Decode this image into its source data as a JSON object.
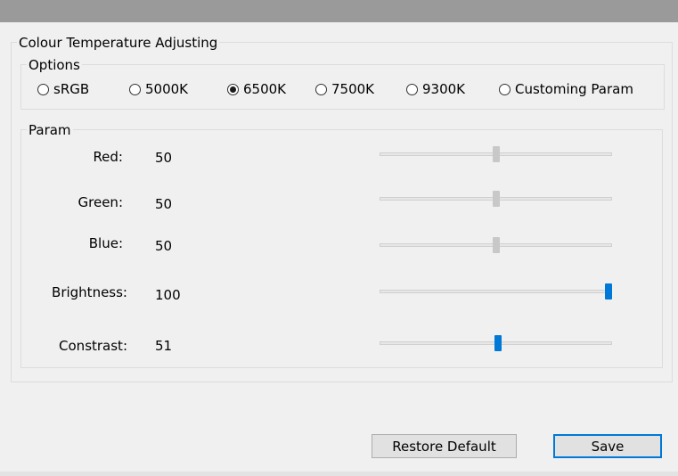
{
  "window": {
    "group_title": "Colour Temperature Adjusting"
  },
  "options": {
    "legend": "Options",
    "items": [
      {
        "label": "sRGB",
        "checked": false
      },
      {
        "label": "5000K",
        "checked": false
      },
      {
        "label": "6500K",
        "checked": true
      },
      {
        "label": "7500K",
        "checked": false
      },
      {
        "label": "9300K",
        "checked": false
      },
      {
        "label": "Customing Param",
        "checked": false
      }
    ]
  },
  "param": {
    "legend": "Param",
    "rows": [
      {
        "label": "Red:",
        "value": "50",
        "fraction": 0.5,
        "enabled": false
      },
      {
        "label": "Green:",
        "value": "50",
        "fraction": 0.5,
        "enabled": false
      },
      {
        "label": "Blue:",
        "value": "50",
        "fraction": 0.5,
        "enabled": false
      },
      {
        "label": "Brightness:",
        "value": "100",
        "fraction": 1.0,
        "enabled": true
      },
      {
        "label": "Constrast:",
        "value": "51",
        "fraction": 0.51,
        "enabled": true
      }
    ]
  },
  "buttons": {
    "restore": "Restore Default",
    "save": "Save"
  },
  "colors": {
    "accent": "#0078d7",
    "disabled_thumb": "#c8c8c8"
  }
}
